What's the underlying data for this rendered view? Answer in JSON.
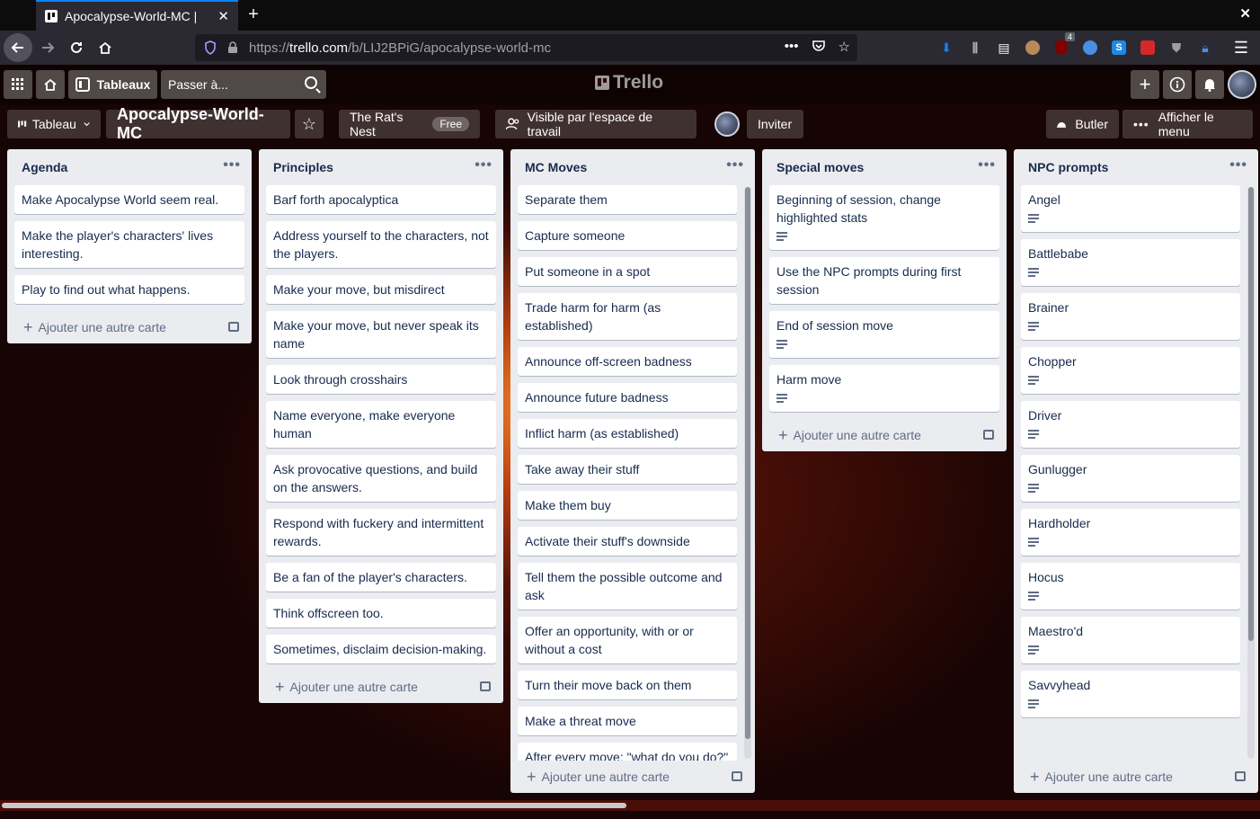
{
  "browser": {
    "tab_title": "Apocalypse-World-MC |",
    "url_prefix": "https://",
    "url_host": "trello.com",
    "url_path": "/b/LIJ2BPiG/apocalypse-world-mc",
    "badge_count": "4",
    "accent_color": "#0a84ff"
  },
  "trello_header": {
    "boards_label": "Tableaux",
    "search_placeholder": "Passer à...",
    "logo_text": "Trello"
  },
  "board_header": {
    "view_label": "Tableau",
    "board_name": "Apocalypse-World-MC",
    "workspace_name": "The Rat's Nest",
    "workspace_badge": "Free",
    "visibility_label": "Visible par l'espace de travail",
    "invite_label": "Inviter",
    "butler_label": "Butler",
    "menu_label": "Afficher le menu"
  },
  "add_card_label": "Ajouter une autre carte",
  "lists": [
    {
      "title": "Agenda",
      "cards": [
        {
          "text": "Make Apocalypse World seem real."
        },
        {
          "text": "Make the player's characters' lives interesting."
        },
        {
          "text": "Play to find out what happens."
        }
      ]
    },
    {
      "title": "Principles",
      "cards": [
        {
          "text": "Barf forth apocalyptica"
        },
        {
          "text": "Address yourself to the characters, not the players."
        },
        {
          "text": "Make your move, but misdirect"
        },
        {
          "text": "Make your move, but never speak its name"
        },
        {
          "text": "Look through crosshairs"
        },
        {
          "text": "Name everyone, make everyone human"
        },
        {
          "text": "Ask provocative questions, and build on the answers."
        },
        {
          "text": "Respond with fuckery and intermittent rewards."
        },
        {
          "text": "Be a fan of the player's characters."
        },
        {
          "text": "Think offscreen too."
        },
        {
          "text": "Sometimes, disclaim decision-making."
        }
      ]
    },
    {
      "title": "MC Moves",
      "cards": [
        {
          "text": "Separate them"
        },
        {
          "text": "Capture someone"
        },
        {
          "text": "Put someone in a spot"
        },
        {
          "text": "Trade harm for harm (as established)"
        },
        {
          "text": "Announce off-screen badness"
        },
        {
          "text": "Announce future badness"
        },
        {
          "text": "Inflict harm (as established)"
        },
        {
          "text": "Take away their stuff"
        },
        {
          "text": "Make them buy"
        },
        {
          "text": "Activate their stuff's downside"
        },
        {
          "text": "Tell them the possible outcome and ask"
        },
        {
          "text": "Offer an opportunity, with or or without a cost"
        },
        {
          "text": "Turn their move back on them"
        },
        {
          "text": "Make a threat move"
        },
        {
          "text": "After every move: \"what do you do?\""
        }
      ]
    },
    {
      "title": "Special moves",
      "cards": [
        {
          "text": "Beginning of session, change highlighted stats",
          "desc": true
        },
        {
          "text": "Use the NPC prompts during first session"
        },
        {
          "text": "End of session move",
          "desc": true
        },
        {
          "text": "Harm move",
          "desc": true
        }
      ]
    },
    {
      "title": "NPC prompts",
      "cards": [
        {
          "text": "Angel",
          "desc": true
        },
        {
          "text": "Battlebabe",
          "desc": true
        },
        {
          "text": "Brainer",
          "desc": true
        },
        {
          "text": "Chopper",
          "desc": true
        },
        {
          "text": "Driver",
          "desc": true
        },
        {
          "text": "Gunlugger",
          "desc": true
        },
        {
          "text": "Hardholder",
          "desc": true
        },
        {
          "text": "Hocus",
          "desc": true
        },
        {
          "text": "Maestro'd",
          "desc": true
        },
        {
          "text": "Savvyhead",
          "desc": true
        }
      ]
    }
  ]
}
